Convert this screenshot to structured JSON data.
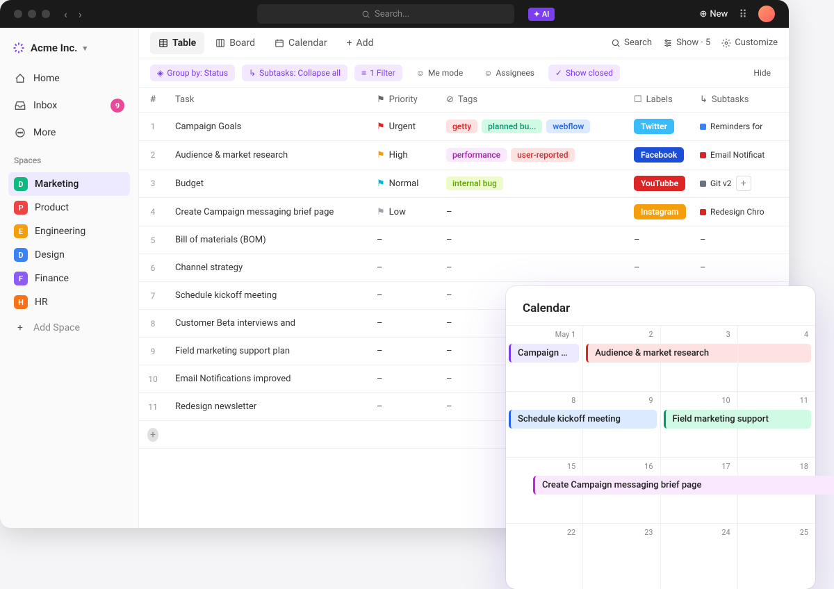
{
  "titlebar": {
    "search_placeholder": "Search...",
    "ai_label": "AI",
    "new_label": "New"
  },
  "workspace": {
    "name": "Acme Inc."
  },
  "nav": {
    "home": "Home",
    "inbox": "Inbox",
    "inbox_count": "9",
    "more": "More"
  },
  "sidebar": {
    "spaces_label": "Spaces",
    "spaces": [
      {
        "letter": "D",
        "color": "#10b981",
        "name": "Marketing",
        "active": true
      },
      {
        "letter": "P",
        "color": "#ef4444",
        "name": "Product"
      },
      {
        "letter": "E",
        "color": "#f59e0b",
        "name": "Engineering"
      },
      {
        "letter": "D",
        "color": "#3b82f6",
        "name": "Design"
      },
      {
        "letter": "F",
        "color": "#8b5cf6",
        "name": "Finance"
      },
      {
        "letter": "H",
        "color": "#f97316",
        "name": "HR"
      }
    ],
    "add_space": "Add Space"
  },
  "views": {
    "table": "Table",
    "board": "Board",
    "calendar": "Calendar",
    "add": "Add",
    "search": "Search",
    "show": "Show · 5",
    "customize": "Customize"
  },
  "filters": {
    "group": "Group by: Status",
    "subtasks": "Subtasks: Collapse all",
    "filter": "1 Filter",
    "me": "Me mode",
    "assignees": "Assignees",
    "closed": "Show closed",
    "hide": "Hide"
  },
  "columns": {
    "num": "#",
    "task": "Task",
    "priority": "Priority",
    "tags": "Tags",
    "labels": "Labels",
    "subtasks": "Subtasks"
  },
  "rows": [
    {
      "num": "1",
      "task": "Campaign Goals",
      "priority": "Urgent",
      "flag": "flag-urgent",
      "tags": [
        {
          "t": "getty",
          "bg": "#fee2e2",
          "c": "#dc2626"
        },
        {
          "t": "planned bu...",
          "bg": "#d1fae5",
          "c": "#059669"
        },
        {
          "t": "webflow",
          "bg": "#dbeafe",
          "c": "#2563eb"
        }
      ],
      "label": {
        "t": "Twitter",
        "bg": "#38bdf8"
      },
      "subtask": {
        "t": "Reminders for",
        "c": "#3b82f6"
      }
    },
    {
      "num": "2",
      "task": "Audience & market research",
      "priority": "High",
      "flag": "flag-high",
      "tags": [
        {
          "t": "performance",
          "bg": "#fae8ff",
          "c": "#a21caf"
        },
        {
          "t": "user-reported",
          "bg": "#fee2e2",
          "c": "#dc2626"
        }
      ],
      "label": {
        "t": "Facebook",
        "bg": "#1d4ed8"
      },
      "subtask": {
        "t": "Email Notificat",
        "c": "#dc2626"
      }
    },
    {
      "num": "3",
      "task": "Budget",
      "priority": "Normal",
      "flag": "flag-normal",
      "tags": [
        {
          "t": "internal bug",
          "bg": "#ecfccb",
          "c": "#65a30d"
        }
      ],
      "label": {
        "t": "YouTubbe",
        "bg": "#dc2626"
      },
      "subtask": {
        "t": "Git v2",
        "c": "#6b7280",
        "plus": true
      }
    },
    {
      "num": "4",
      "task": "Create Campaign messaging brief page",
      "priority": "Low",
      "flag": "flag-low",
      "tags": [
        {
          "t": "–"
        }
      ],
      "label": {
        "t": "Instagram",
        "bg": "#f59e0b"
      },
      "subtask": {
        "t": "Redesign Chro",
        "c": "#dc2626"
      }
    },
    {
      "num": "5",
      "task": "Bill of materials (BOM)",
      "dash": true
    },
    {
      "num": "6",
      "task": "Channel strategy",
      "dash": true
    },
    {
      "num": "7",
      "task": "Schedule kickoff meeting",
      "dash": true
    },
    {
      "num": "8",
      "task": "Customer Beta interviews and",
      "dash": true
    },
    {
      "num": "9",
      "task": "Field marketing support plan",
      "dash": true
    },
    {
      "num": "10",
      "task": "Email Notifications improved",
      "dash": true
    },
    {
      "num": "11",
      "task": "Redesign newsletter",
      "dash": true
    }
  ],
  "calendar": {
    "title": "Calendar",
    "dates": [
      "May 1",
      "2",
      "3",
      "4",
      "8",
      "9",
      "10",
      "11",
      "15",
      "16",
      "17",
      "18",
      "22",
      "23",
      "24",
      "25"
    ],
    "events": [
      {
        "row": 0,
        "col": 0,
        "span": 1,
        "t": "Campaign Goals",
        "bg": "#ede9fe",
        "bc": "#7c3aed"
      },
      {
        "row": 0,
        "col": 1,
        "span": 3,
        "t": "Audience & market research",
        "bg": "#fee2e2",
        "bc": "#dc2626"
      },
      {
        "row": 1,
        "col": 0,
        "span": 2,
        "t": "Schedule kickoff meeting",
        "bg": "#dbeafe",
        "bc": "#2563eb"
      },
      {
        "row": 1,
        "col": 2,
        "span": 2,
        "t": "Field marketing support",
        "bg": "#d1fae5",
        "bc": "#059669"
      },
      {
        "row": 2,
        "col": 0,
        "span": 4,
        "t": "Create Campaign messaging brief page",
        "bg": "#fae8ff",
        "bc": "#c026d3"
      }
    ]
  }
}
